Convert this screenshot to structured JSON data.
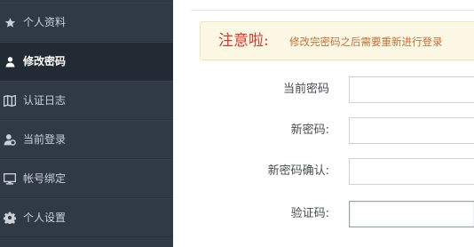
{
  "sidebar": {
    "items": [
      {
        "label": "个人资料",
        "icon": "star-icon",
        "active": false
      },
      {
        "label": "修改密码",
        "icon": "user-icon",
        "active": true
      },
      {
        "label": "认证日志",
        "icon": "book-icon",
        "active": false
      },
      {
        "label": "当前登录",
        "icon": "user-settings-icon",
        "active": false
      },
      {
        "label": "帐号绑定",
        "icon": "monitor-icon",
        "active": false
      },
      {
        "label": "个人设置",
        "icon": "gear-icon",
        "active": false
      }
    ]
  },
  "notice": {
    "title": "注意啦:",
    "text": "修改完密码之后需要重新进行登录"
  },
  "form": {
    "current_password_label": "当前密码",
    "new_password_label": "新密码:",
    "confirm_password_label": "新密码确认:",
    "captcha_label": "验证码:"
  },
  "colors": {
    "sidebar_bg": "#2f3a45",
    "sidebar_active_bg": "#222b33",
    "notice_bg": "#fcf8e3",
    "notice_title": "#d9362f",
    "notice_text": "#c0703a"
  }
}
